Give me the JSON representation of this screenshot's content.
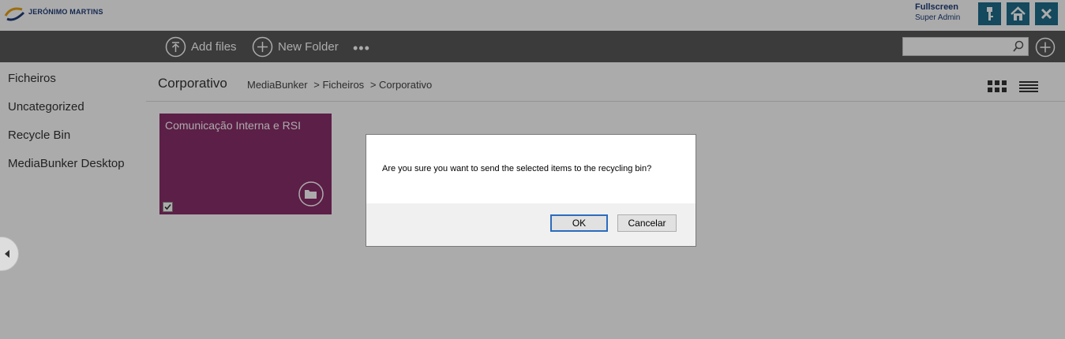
{
  "header": {
    "logo_text": "JERÓNIMO MARTINS",
    "user_name": "Fullscreen",
    "user_role": "Super Admin",
    "icons": [
      "key-icon",
      "home-icon",
      "close-icon"
    ]
  },
  "toolbar": {
    "add_files": "Add files",
    "new_folder": "New Folder",
    "more": "•••",
    "search_placeholder": ""
  },
  "sidebar": {
    "items": [
      {
        "label": "Ficheiros"
      },
      {
        "label": "Uncategorized"
      },
      {
        "label": "Recycle Bin"
      },
      {
        "label": "MediaBunker Desktop"
      }
    ]
  },
  "main": {
    "title": "Corporativo",
    "breadcrumb": [
      "MediaBunker",
      "> Ficheiros",
      "> Corporativo"
    ],
    "tiles": [
      {
        "title": "Comunicação Interna e RSI",
        "color": "#8a2f6b",
        "checked": true
      }
    ]
  },
  "dialog": {
    "message": "Are you sure you want to send the selected items to the recycling bin?",
    "ok_label": "OK",
    "cancel_label": "Cancelar"
  },
  "colors": {
    "toolbar_bg": "#595959",
    "accent": "#1e6e8c",
    "tile": "#8a2f6b",
    "overlay": "rgba(0,0,0,0.33)"
  }
}
